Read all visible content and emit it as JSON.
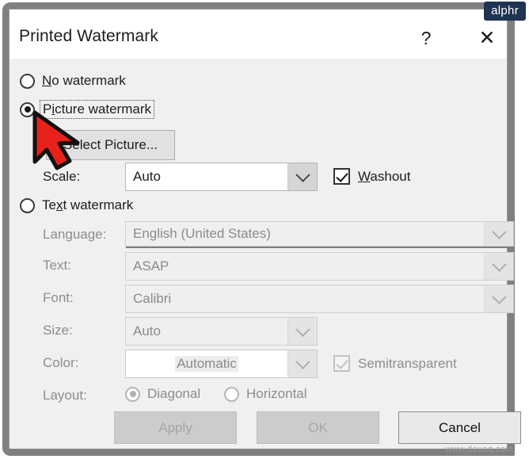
{
  "window": {
    "title": "Printed Watermark",
    "help_label": "?",
    "close_label": "✕"
  },
  "branding": {
    "badge": "alphr",
    "footer_watermark": "www.deuaq.com"
  },
  "options": {
    "no_watermark": {
      "label": "No watermark",
      "accel": "N",
      "selected": false
    },
    "picture_watermark": {
      "label": "Picture watermark",
      "accel": "P",
      "selected": true,
      "focused": true
    },
    "text_watermark": {
      "label": "Text watermark",
      "accel": "x",
      "selected": false
    }
  },
  "picture_section": {
    "select_picture_button": "Select Picture...",
    "scale_label": "Scale:",
    "scale_value": "Auto",
    "washout_label": "Washout",
    "washout_checked": true
  },
  "text_section": {
    "language_label": "Language:",
    "language_value": "English (United States)",
    "text_label": "Text:",
    "text_value": "ASAP",
    "font_label": "Font:",
    "font_value": "Calibri",
    "size_label": "Size:",
    "size_value": "Auto",
    "color_label": "Color:",
    "color_value": "Automatic",
    "semitransparent_label": "Semitransparent",
    "semitransparent_checked": true,
    "layout_label": "Layout:",
    "layout_diagonal": "Diagonal",
    "layout_horizontal": "Horizontal",
    "layout_selected": "Diagonal"
  },
  "footer": {
    "apply": "Apply",
    "ok": "OK",
    "cancel": "Cancel"
  },
  "colors": {
    "dialog_bg": "#f0f0f0",
    "titlebar_bg": "#ffffff",
    "frame": "#808080",
    "badge_bg": "#1f3352",
    "cursor_red": "#e8211b",
    "disabled_text": "#8d8d8d"
  }
}
